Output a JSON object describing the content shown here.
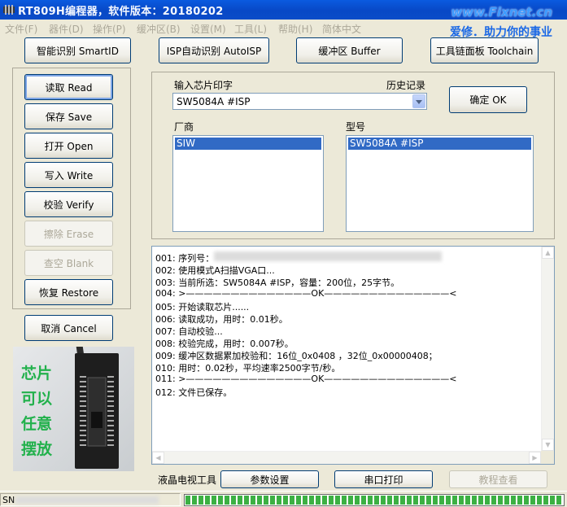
{
  "window": {
    "title": "RT809H编程器，软件版本：20180202"
  },
  "watermark": {
    "url": "www.Fixnet.cn",
    "slogan": "爱修．助力你的事业"
  },
  "menu": [
    "文件(F)",
    "器件(D)",
    "操作(P)",
    "缓冲区(B)",
    "设置(M)",
    "工具(L)",
    "帮助(H)",
    "简体中文"
  ],
  "top_buttons": {
    "smartid": "智能识别 SmartID",
    "autoisp": "ISP自动识别 AutoISP",
    "buffer": "缓冲区 Buffer",
    "toolchain": "工具链面板 Toolchain"
  },
  "side_buttons": {
    "read": "读取 Read",
    "save": "保存 Save",
    "open": "打开 Open",
    "write": "写入 Write",
    "verify": "校验 Verify",
    "erase": "擦除 Erase",
    "blank": "查空 Blank",
    "restore": "恢复 Restore",
    "cancel": "取消 Cancel"
  },
  "chip_input": {
    "label": "输入芯片印字",
    "history_label": "历史记录",
    "value": "SW5084A #ISP",
    "ok_button": "确定 OK"
  },
  "vendor": {
    "label": "厂商",
    "selected": "SIW"
  },
  "model": {
    "label": "型号",
    "selected": "SW5084A #ISP"
  },
  "log": [
    "001: 序列号：",
    "002: 使用模式A扫描VGA口...",
    "003: 当前所选：SW5084A #ISP，容量：200位，25字节。",
    "004: >——————————————OK——————————————<",
    "005: 开始读取芯片......",
    "006: 读取成功，用时：0.01秒。",
    "007: 自动校验...",
    "008: 校验完成，用时：0.007秒。",
    "009: 缓冲区数据累加校验和：16位_0x0408 ，32位_0x00000408；",
    "010: 用时：0.02秒，平均速率2500字节/秒。",
    "011: >——————————————OK——————————————<",
    "012: 文件已保存。"
  ],
  "chip_photo_text": [
    "芯片",
    "可以",
    "任意",
    "摆放"
  ],
  "bottom": {
    "lcd_label": "液晶电视工具",
    "params_button": "参数设置",
    "serial_button": "串口打印",
    "tutorial_button": "教程查看"
  },
  "status": {
    "sn_label": "SN",
    "progress": 1.0
  }
}
